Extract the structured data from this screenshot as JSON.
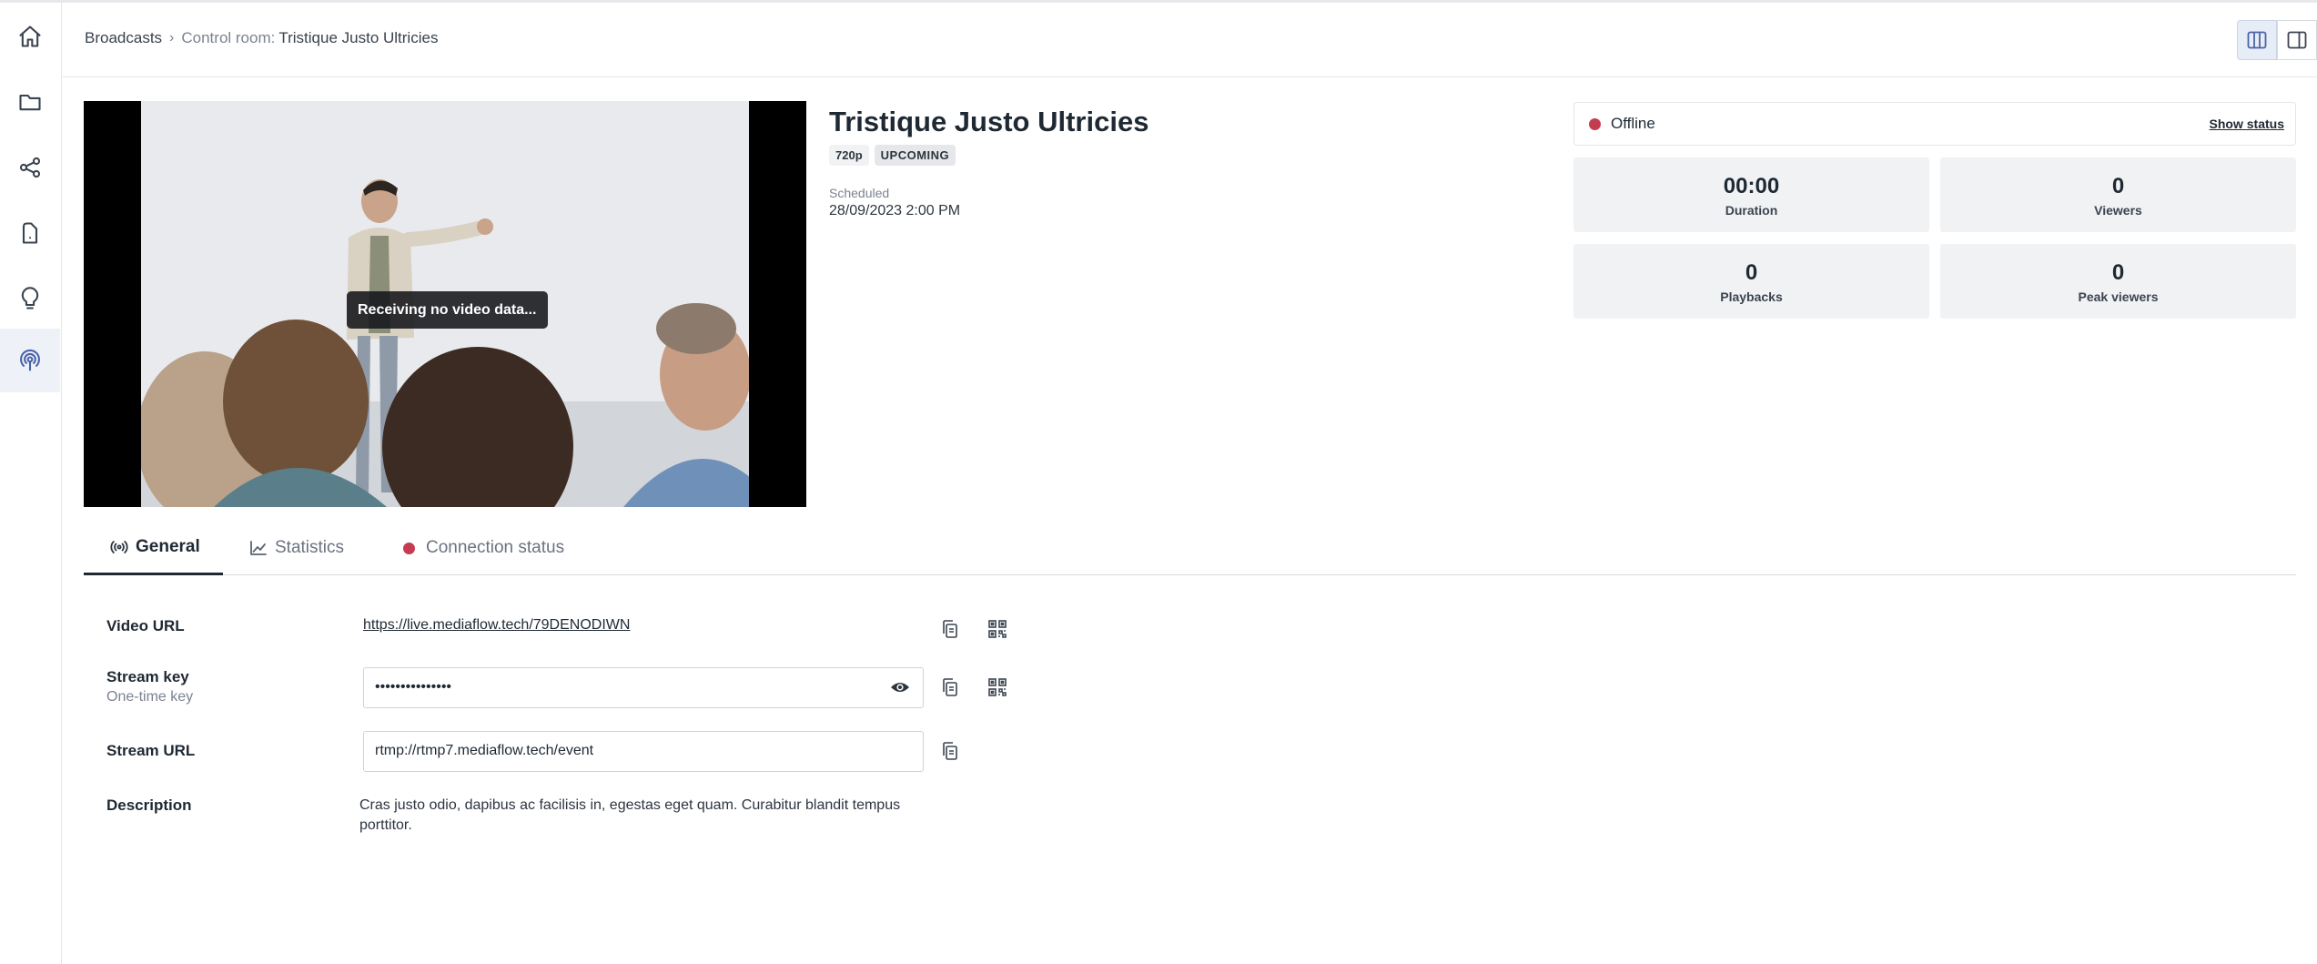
{
  "rail": {
    "items": [
      {
        "name": "home"
      },
      {
        "name": "folder"
      },
      {
        "name": "share"
      },
      {
        "name": "mobile"
      },
      {
        "name": "idea"
      },
      {
        "name": "broadcast"
      }
    ]
  },
  "header": {
    "breadcrumb_root": "Broadcasts",
    "breadcrumb_prefix": "Control room:",
    "breadcrumb_current": "Tristique Justo Ultricies"
  },
  "video": {
    "overlay_text": "Receiving no video data..."
  },
  "broadcast": {
    "title": "Tristique Justo Ultricies",
    "resolution_badge": "720p",
    "state_badge": "UPCOMING",
    "scheduled_label": "Scheduled",
    "scheduled_value": "28/09/2023 2:00 PM"
  },
  "status": {
    "text": "Offline",
    "show_status_label": "Show status",
    "dot_color": "#c53b50"
  },
  "stats": {
    "duration_value": "00:00",
    "duration_label": "Duration",
    "viewers_value": "0",
    "viewers_label": "Viewers",
    "playbacks_value": "0",
    "playbacks_label": "Playbacks",
    "peak_value": "0",
    "peak_label": "Peak viewers"
  },
  "tabs": {
    "general": "General",
    "statistics": "Statistics",
    "connection": "Connection status"
  },
  "form": {
    "video_url_label": "Video URL",
    "video_url_value": "https://live.mediaflow.tech/79DENODIWN",
    "stream_key_label": "Stream key",
    "stream_key_sublabel": "One-time key",
    "stream_key_value": "•••••••••••••••",
    "stream_url_label": "Stream URL",
    "stream_url_value": "rtmp://rtmp7.mediaflow.tech/event",
    "description_label": "Description",
    "description_value": "Cras justo odio, dapibus ac facilisis in, egestas eget quam. Curabitur blandit tempus porttitor."
  }
}
